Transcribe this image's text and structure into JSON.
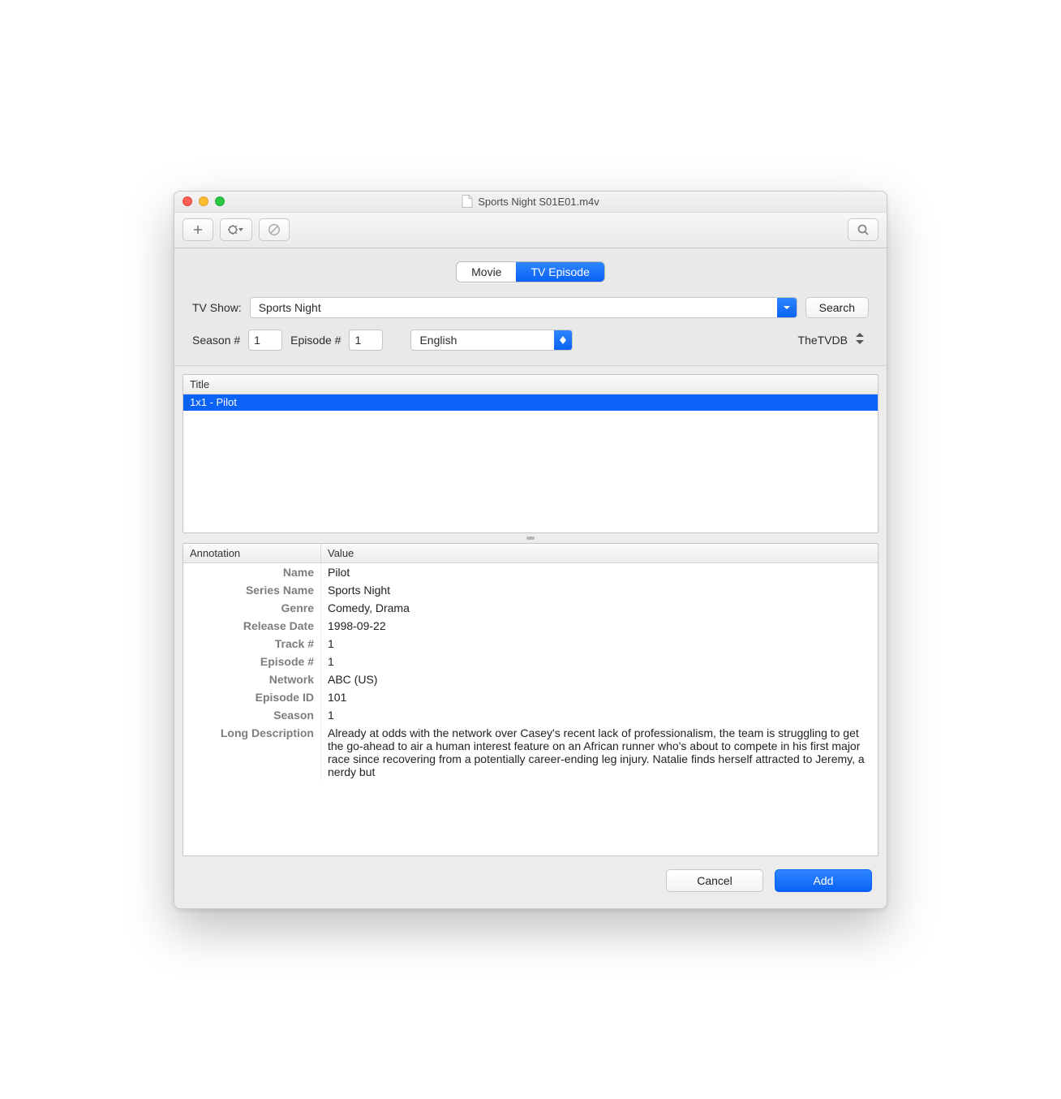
{
  "window": {
    "title": "Sports Night S01E01.m4v"
  },
  "segmented": {
    "movie": "Movie",
    "tv": "TV Episode",
    "active": "tv"
  },
  "form": {
    "tvshow_label": "TV Show:",
    "tvshow_value": "Sports Night",
    "search_label": "Search",
    "season_label": "Season #",
    "season_value": "1",
    "episode_label": "Episode #",
    "episode_value": "1",
    "language_value": "English",
    "source_value": "TheTVDB"
  },
  "results": {
    "header": "Title",
    "rows": [
      "1x1 - Pilot"
    ]
  },
  "annotations": {
    "header_ann": "Annotation",
    "header_val": "Value",
    "rows": [
      {
        "k": "Name",
        "v": "Pilot"
      },
      {
        "k": "Series Name",
        "v": "Sports Night"
      },
      {
        "k": "Genre",
        "v": "Comedy, Drama"
      },
      {
        "k": "Release Date",
        "v": "1998-09-22"
      },
      {
        "k": "Track #",
        "v": "1"
      },
      {
        "k": "Episode #",
        "v": "1"
      },
      {
        "k": "Network",
        "v": "ABC (US)"
      },
      {
        "k": "Episode ID",
        "v": "101"
      },
      {
        "k": "Season",
        "v": "1"
      },
      {
        "k": "Long Description",
        "v": "Already at odds with the network over Casey's recent lack of professionalism, the team is struggling to get the go-ahead to air a human interest feature on an African runner who's about to compete in his first major race since recovering from a potentially career-ending leg injury. Natalie finds herself attracted to Jeremy, a nerdy but"
      }
    ]
  },
  "footer": {
    "cancel": "Cancel",
    "add": "Add"
  }
}
